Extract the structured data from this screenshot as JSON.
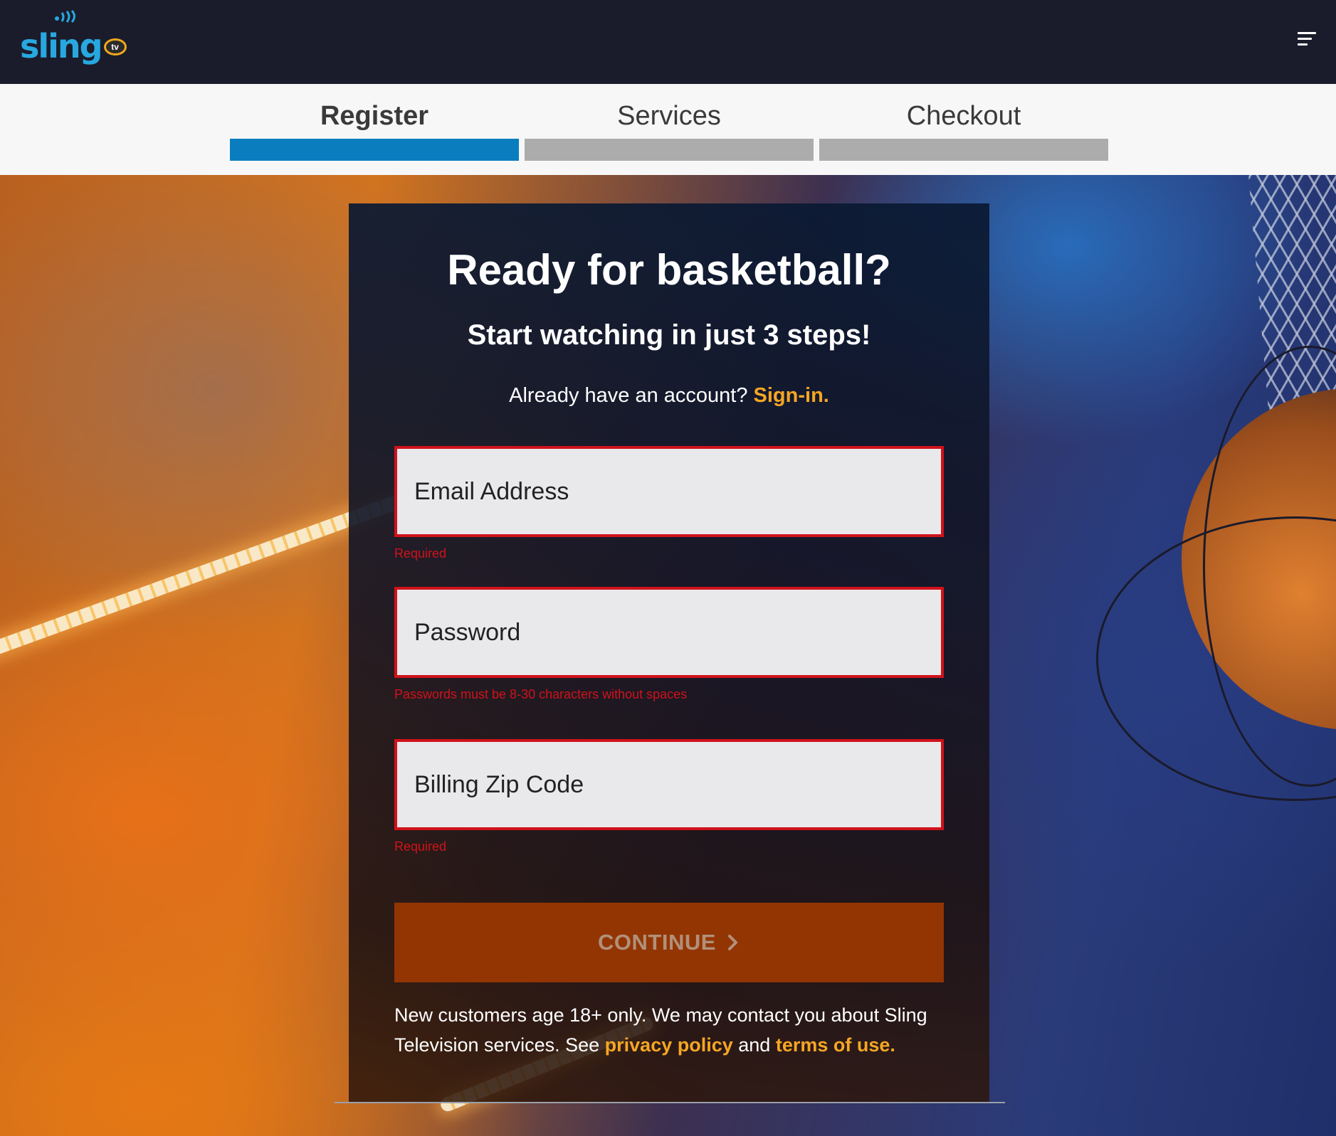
{
  "brand": {
    "wordmark": "sling",
    "badge": "tv"
  },
  "steps": [
    {
      "label": "Register",
      "active": true
    },
    {
      "label": "Services",
      "active": false
    },
    {
      "label": "Checkout",
      "active": false
    }
  ],
  "form": {
    "title": "Ready for basketball?",
    "subtitle": "Start watching in just 3 steps!",
    "account_prompt": "Already have an account?",
    "signin_link": "Sign-in.",
    "email": {
      "placeholder": "Email Address",
      "value": "",
      "error": "Required"
    },
    "password": {
      "placeholder": "Password",
      "value": "",
      "error": "Passwords must be 8-30 characters without spaces"
    },
    "zip": {
      "placeholder": "Billing Zip Code",
      "value": "",
      "error": "Required"
    },
    "continue_label": "CONTINUE",
    "disclaimer_text": "New customers age 18+ only. We may contact you about Sling Television services. See",
    "privacy_link": "privacy policy",
    "and_text": "and",
    "terms_link": "terms of use."
  },
  "colors": {
    "topbar": "#1b1c2b",
    "step_active": "#0a7dbf",
    "step_inactive": "#acacac",
    "link_accent": "#f5a623",
    "error": "#d0121b",
    "continue_bg": "#933503"
  },
  "icons": [
    "hamburger-menu-icon",
    "chevron-right-icon",
    "signal-waves-icon"
  ]
}
